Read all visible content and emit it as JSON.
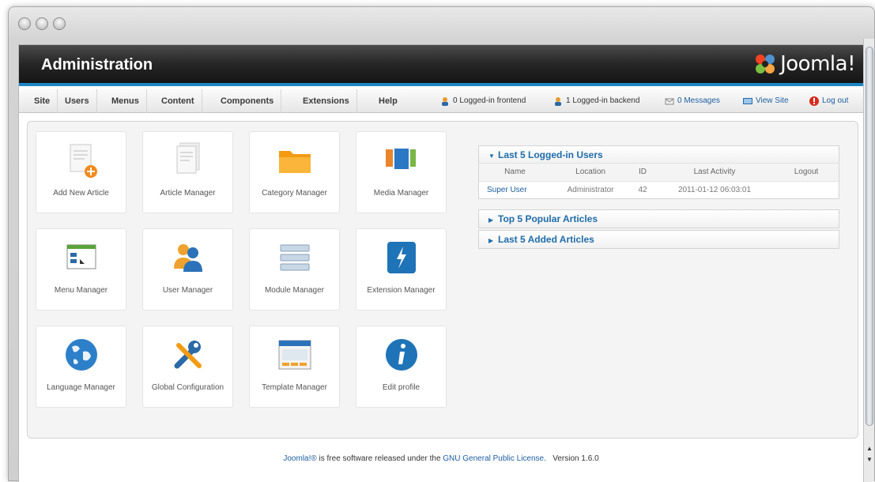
{
  "header": {
    "title": "Administration",
    "logo_text": "Joomla!"
  },
  "menu": [
    "Site",
    "Users",
    "Menus",
    "Content",
    "Components",
    "Extensions",
    "Help"
  ],
  "status": {
    "frontend": "0 Logged-in frontend",
    "backend": "1 Logged-in backend",
    "messages": "0 Messages",
    "view_site": "View Site",
    "logout": "Log out"
  },
  "tiles": [
    {
      "label": "Add New Article",
      "icon": "add-article-icon"
    },
    {
      "label": "Article Manager",
      "icon": "article-icon"
    },
    {
      "label": "Category Manager",
      "icon": "folder-icon"
    },
    {
      "label": "Media Manager",
      "icon": "media-icon"
    },
    {
      "label": "Menu Manager",
      "icon": "menu-icon"
    },
    {
      "label": "User Manager",
      "icon": "users-icon"
    },
    {
      "label": "Module Manager",
      "icon": "module-icon"
    },
    {
      "label": "Extension Manager",
      "icon": "extension-icon"
    },
    {
      "label": "Language Manager",
      "icon": "globe-icon"
    },
    {
      "label": "Global Configuration",
      "icon": "tools-icon"
    },
    {
      "label": "Template Manager",
      "icon": "template-icon"
    },
    {
      "label": "Edit profile",
      "icon": "info-icon"
    }
  ],
  "panels": {
    "logged_in": {
      "title": "Last 5 Logged-in Users",
      "columns": [
        "Name",
        "Location",
        "ID",
        "Last Activity",
        "Logout"
      ],
      "rows": [
        {
          "name": "Super User",
          "location": "Administrator",
          "id": "42",
          "last_activity": "2011-01-12 06:03:01",
          "logout": ""
        }
      ]
    },
    "popular": {
      "title": "Top 5 Popular Articles"
    },
    "added": {
      "title": "Last 5 Added Articles"
    }
  },
  "footer": {
    "brand": "Joomla!®",
    "text1": " is free software released under the ",
    "license": "GNU General Public License.",
    "version": "Version 1.6.0"
  },
  "colors": {
    "accent": "#1f86c4",
    "link": "#1e5fa0"
  }
}
